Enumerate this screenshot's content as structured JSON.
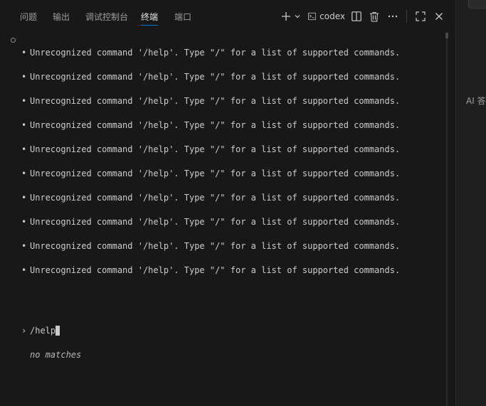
{
  "tabs": [
    {
      "label": "问题",
      "active": false
    },
    {
      "label": "输出",
      "active": false
    },
    {
      "label": "调试控制台",
      "active": false
    },
    {
      "label": "终端",
      "active": true
    },
    {
      "label": "端口",
      "active": false
    }
  ],
  "toolbar": {
    "new_terminal_icon": "plus-icon",
    "dropdown_icon": "chevron-down-icon",
    "terminal_name": "codex",
    "terminal_icon": "terminal-icon",
    "split_icon": "split-icon",
    "kill_icon": "trash-icon",
    "more_icon": "ellipsis-icon",
    "maximize_icon": "maximize-icon",
    "close_icon": "close-icon"
  },
  "terminal": {
    "messages": [
      "Unrecognized command '/help'. Type \"/\" for a list of supported commands.",
      "Unrecognized command '/help'. Type \"/\" for a list of supported commands.",
      "Unrecognized command '/help'. Type \"/\" for a list of supported commands.",
      "Unrecognized command '/help'. Type \"/\" for a list of supported commands.",
      "Unrecognized command '/help'. Type \"/\" for a list of supported commands.",
      "Unrecognized command '/help'. Type \"/\" for a list of supported commands.",
      "Unrecognized command '/help'. Type \"/\" for a list of supported commands.",
      "Unrecognized command '/help'. Type \"/\" for a list of supported commands.",
      "Unrecognized command '/help'. Type \"/\" for a list of supported commands.",
      "Unrecognized command '/help'. Type \"/\" for a list of supported commands."
    ],
    "bullet": "•",
    "prompt_symbol": "›",
    "input_value": "/help",
    "hint": "no matches"
  },
  "side_panel": {
    "label": "AI 答"
  },
  "colors": {
    "background": "#181818",
    "accent": "#0078d4",
    "text": "#cccccc"
  }
}
